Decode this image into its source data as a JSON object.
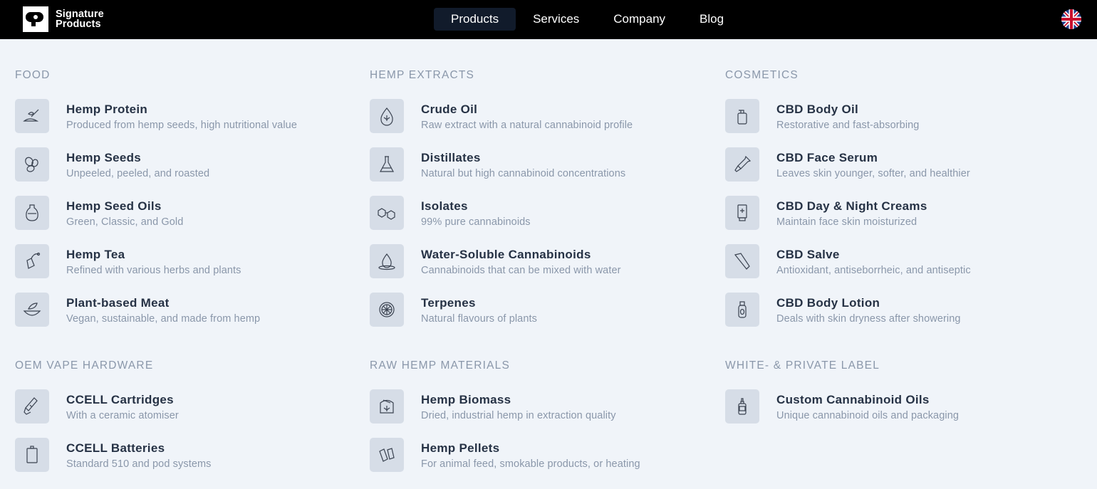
{
  "brand": {
    "line1": "Signature",
    "line2": "Products"
  },
  "nav": [
    {
      "label": "Products",
      "active": true
    },
    {
      "label": "Services",
      "active": false
    },
    {
      "label": "Company",
      "active": false
    },
    {
      "label": "Blog",
      "active": false
    }
  ],
  "language": {
    "icon": "uk-flag-icon"
  },
  "sections": [
    {
      "title": "FOOD",
      "items": [
        {
          "title": "Hemp Protein",
          "desc": "Produced from hemp seeds, high nutritional value",
          "icon": "scoop-icon"
        },
        {
          "title": "Hemp Seeds",
          "desc": "Unpeeled, peeled, and roasted",
          "icon": "seeds-icon"
        },
        {
          "title": "Hemp Seed Oils",
          "desc": "Green, Classic, and Gold",
          "icon": "oil-jug-icon"
        },
        {
          "title": "Hemp Tea",
          "desc": "Refined with various herbs and plants",
          "icon": "tea-bag-icon"
        },
        {
          "title": "Plant-based Meat",
          "desc": "Vegan, sustainable, and made from hemp",
          "icon": "bowl-leaf-icon"
        }
      ]
    },
    {
      "title": "HEMP EXTRACTS",
      "items": [
        {
          "title": "Crude Oil",
          "desc": "Raw extract with a natural cannabinoid profile",
          "icon": "oil-drop-icon"
        },
        {
          "title": "Distillates",
          "desc": "Natural but high cannabinoid concentrations",
          "icon": "flask-icon"
        },
        {
          "title": "Isolates",
          "desc": "99% pure cannabinoids",
          "icon": "molecule-icon"
        },
        {
          "title": "Water-Soluble Cannabinoids",
          "desc": "Cannabinoids that can be mixed with water",
          "icon": "water-drop-icon"
        },
        {
          "title": "Terpenes",
          "desc": "Natural flavours of plants",
          "icon": "citrus-icon"
        }
      ]
    },
    {
      "title": "COSMETICS",
      "items": [
        {
          "title": "CBD Body Oil",
          "desc": "Restorative and fast-absorbing",
          "icon": "pump-bottle-icon"
        },
        {
          "title": "CBD Face Serum",
          "desc": "Leaves skin younger, softer, and healthier",
          "icon": "dropper-icon"
        },
        {
          "title": "CBD Day & Night Creams",
          "desc": "Maintain face skin moisturized",
          "icon": "cream-tube-icon"
        },
        {
          "title": "CBD Salve",
          "desc": "Antioxidant, antiseborrheic, and antiseptic",
          "icon": "salve-tube-icon"
        },
        {
          "title": "CBD Body Lotion",
          "desc": "Deals with skin dryness after showering",
          "icon": "lotion-bottle-icon"
        }
      ]
    },
    {
      "title": "OEM VAPE HARDWARE",
      "items": [
        {
          "title": "CCELL Cartridges",
          "desc": "With a ceramic atomiser",
          "icon": "cartridge-icon"
        },
        {
          "title": "CCELL Batteries",
          "desc": "Standard 510 and pod systems",
          "icon": "battery-icon"
        }
      ]
    },
    {
      "title": "RAW HEMP MATERIALS",
      "items": [
        {
          "title": "Hemp Biomass",
          "desc": "Dried, industrial hemp in extraction quality",
          "icon": "biomass-bag-icon"
        },
        {
          "title": "Hemp Pellets",
          "desc": "For animal feed, smokable products, or heating",
          "icon": "pellets-icon"
        }
      ]
    },
    {
      "title": "WHITE- & PRIVATE LABEL",
      "items": [
        {
          "title": "Custom Cannabinoid Oils",
          "desc": "Unique cannabinoid oils and packaging",
          "icon": "label-bottle-icon"
        }
      ]
    }
  ]
}
